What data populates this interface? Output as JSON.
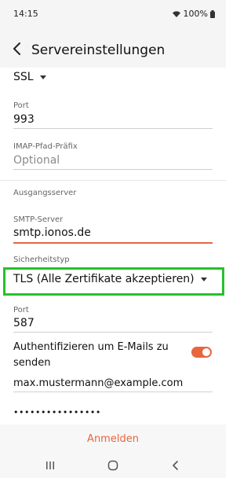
{
  "status": {
    "time": "14:15",
    "battery": "100%"
  },
  "header": {
    "title": "Servereinstellungen"
  },
  "incoming": {
    "security_value": "SSL",
    "port_label": "Port",
    "port_value": "993",
    "imap_prefix_label": "IMAP-Pfad-Präfix",
    "imap_prefix_placeholder": "Optional"
  },
  "outgoing": {
    "section_title": "Ausgangsserver",
    "smtp_label": "SMTP-Server",
    "smtp_value": "smtp.ionos.de",
    "security_label": "Sicherheitstyp",
    "security_value": "TLS (Alle Zertifikate akzeptieren)",
    "port_label": "Port",
    "port_value": "587",
    "auth_label": "Authentifizieren um E-Mails zu senden",
    "auth_enabled": true,
    "username_value": "max.mustermann@example.com",
    "password_value": "••••••••••••••••"
  },
  "footer": {
    "login_label": "Anmelden"
  },
  "colors": {
    "accent": "#e8663d",
    "highlight": "#27c02c"
  },
  "icons": [
    "back-arrow-icon",
    "caret-down-icon",
    "wifi-icon",
    "battery-icon",
    "recent-apps-icon",
    "home-icon",
    "nav-back-icon"
  ]
}
